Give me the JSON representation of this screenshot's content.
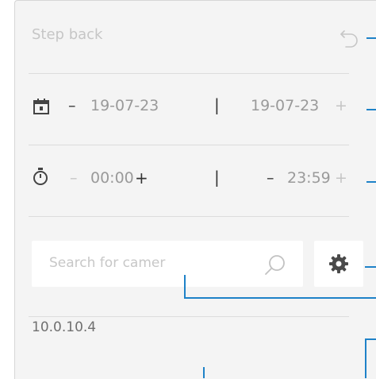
{
  "step_back": {
    "label": "Step back",
    "icon": "undo-icon"
  },
  "date_range": {
    "icon": "calendar-icon",
    "start_minus": "–",
    "start_value": "19-07-23",
    "separator": "|",
    "end_value": "19-07-23",
    "end_plus": "+"
  },
  "time_range": {
    "icon": "stopwatch-icon",
    "start_minus": "–",
    "start_value": "00:00",
    "start_plus": "+",
    "separator": "|",
    "end_minus": "–",
    "end_value": "23:59",
    "end_plus": "+"
  },
  "search": {
    "placeholder": "Search for camer",
    "icon": "search-icon"
  },
  "settings": {
    "icon": "gear-icon"
  },
  "camera_list": {
    "items": [
      "10.0.10.4"
    ]
  },
  "colors": {
    "panel": "#f4f4f4",
    "callout": "#1e82c8",
    "divider": "#dcdcdc"
  }
}
